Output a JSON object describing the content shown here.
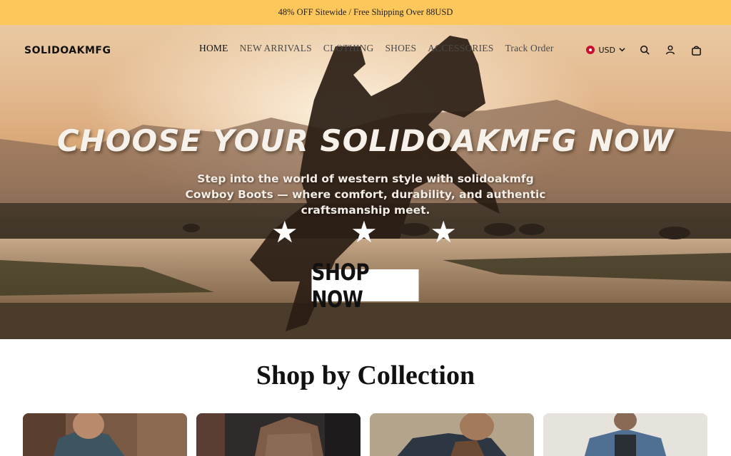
{
  "announcement": "48% OFF Sitewide / Free Shipping Over 88USD",
  "brand": "SOLIDOAKMFG",
  "nav": [
    {
      "label": "HOME",
      "name": "nav-home"
    },
    {
      "label": "NEW ARRIVALS",
      "name": "nav-new-arrivals"
    },
    {
      "label": "CLOTHING",
      "name": "nav-clothing"
    },
    {
      "label": "SHOES",
      "name": "nav-shoes"
    },
    {
      "label": "ACCESSORIES",
      "name": "nav-accessories"
    },
    {
      "label": "Track Order",
      "name": "nav-track-order"
    }
  ],
  "currency": {
    "code": "USD",
    "icon": "hong-kong-flag-icon"
  },
  "tools": {
    "search_icon": "search-icon",
    "account_icon": "user-icon",
    "cart_icon": "bag-icon"
  },
  "hero": {
    "title": "CHOOSE YOUR SOLIDOAKMFG NOW",
    "subtitle": "Step into the world of western style with solidoakmfg Cowboy Boots — where comfort, durability, and authentic craftsmanship meet.",
    "stars": [
      "★",
      "★",
      "★"
    ],
    "cta": "SHOP NOW"
  },
  "collections": {
    "title": "Shop by Collection",
    "cards": [
      {
        "name": "collection-card-1"
      },
      {
        "name": "collection-card-2"
      },
      {
        "name": "collection-card-3"
      },
      {
        "name": "collection-card-4"
      }
    ]
  },
  "colors": {
    "announcement_bg": "#fdc75c",
    "cta_bg": "#ffffff"
  }
}
